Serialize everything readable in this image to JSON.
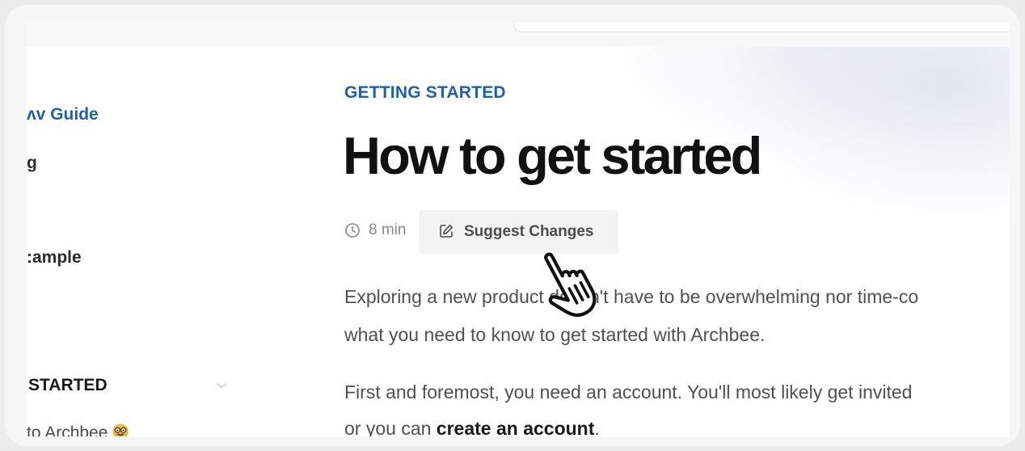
{
  "sidebar": {
    "guide_title": "ʌv Guide",
    "items": [
      {
        "label": "g"
      },
      {
        "label": ":ample"
      }
    ],
    "section": {
      "label": "STARTED",
      "expanded": true
    },
    "pages": [
      {
        "label": "to Archbee",
        "emoji": "nerd-face-icon"
      }
    ]
  },
  "main": {
    "breadcrumb": "GETTING STARTED",
    "title": "How to get started",
    "read_time": "8 min",
    "suggest_label": "Suggest Changes",
    "paragraphs": {
      "p1_line1": "Exploring a new product doesn't have to be overwhelming nor time-co",
      "p1_line2": "what you need to know to get started with Archbee.",
      "p2_line1": "First and foremost, you need an account. You'll most likely get invited",
      "p2_line2_prefix": "or you can ",
      "p2_line2_link": "create an account",
      "p2_line2_suffix": "."
    }
  },
  "colors": {
    "accent": "#1f5fae",
    "title": "#111111",
    "body_text": "#505050",
    "muted": "#8a8a8a"
  },
  "icons": [
    "clock-icon",
    "edit-icon",
    "chevron-down-icon",
    "hand-pointer-cursor-icon",
    "nerd-face-icon"
  ]
}
